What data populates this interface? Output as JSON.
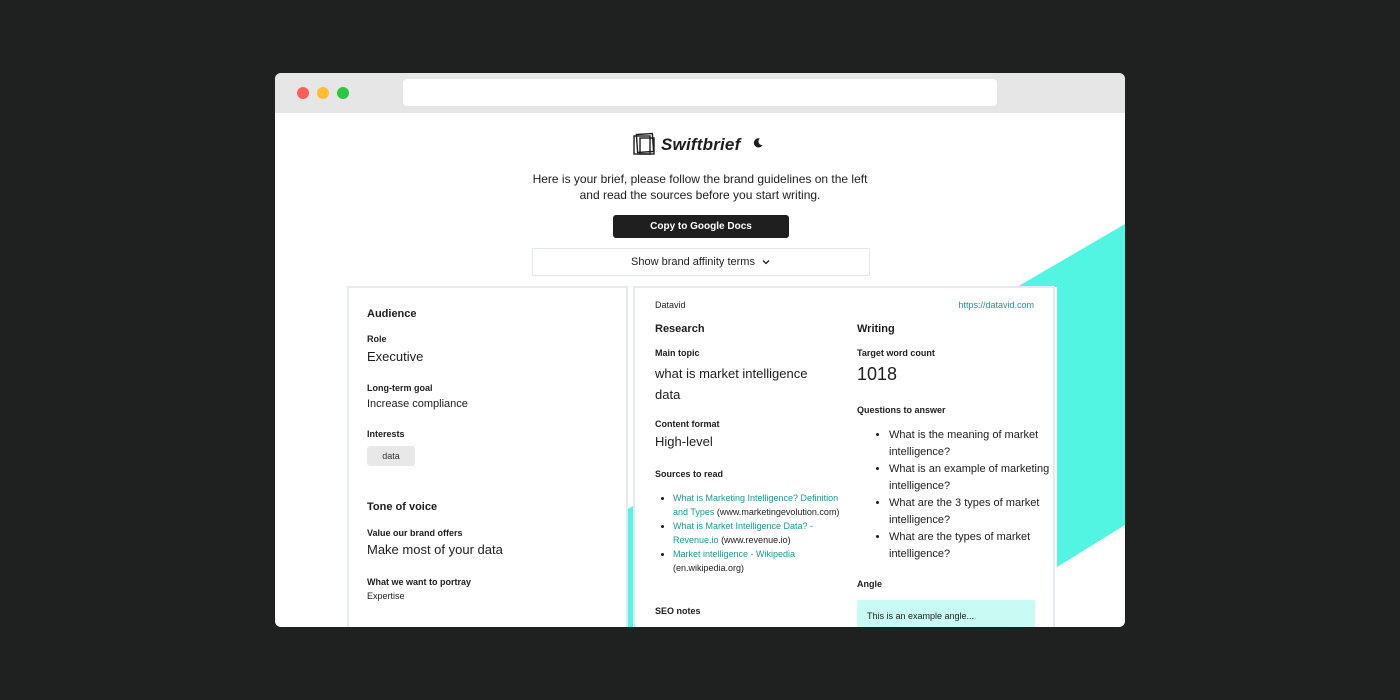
{
  "app": {
    "brand_name": "Swiftbrief",
    "intro_text": "Here is your brief, please follow the brand guidelines on the left and read the sources before you start writing.",
    "copy_button_label": "Copy to Google Docs",
    "affinity_toggle_label": "Show brand affinity terms",
    "accent_color": "#52f5e2"
  },
  "audience": {
    "heading": "Audience",
    "role_label": "Role",
    "role_value": "Executive",
    "goal_label": "Long-term goal",
    "goal_value": "Increase compliance",
    "interests_label": "Interests",
    "interests": [
      "data"
    ]
  },
  "tone": {
    "heading": "Tone of voice",
    "value_label": "Value our brand offers",
    "value_value": "Make most of your data",
    "portray_label": "What we want to portray",
    "portray_value": "Expertise"
  },
  "brief": {
    "company": "Datavid",
    "company_url": "https://datavid.com",
    "research": {
      "heading": "Research",
      "topic_label": "Main topic",
      "topic_value": "what is market intelligence data",
      "format_label": "Content format",
      "format_value": "High-level",
      "sources_label": "Sources to read",
      "sources": [
        {
          "title": "What is Marketing Intelligence? Definition and Types",
          "domain": "(www.marketingevolution.com)"
        },
        {
          "title": "What is Market Intelligence Data? - Revenue.io",
          "domain": "(www.revenue.io)"
        },
        {
          "title": "Market intelligence - Wikipedia",
          "domain": "(en.wikipedia.org)"
        }
      ],
      "seo_label": "SEO notes"
    },
    "writing": {
      "heading": "Writing",
      "word_count_label": "Target word count",
      "word_count_value": "1018",
      "questions_label": "Questions to answer",
      "questions": [
        "What is the meaning of market intelligence?",
        "What is an example of marketing intelligence?",
        "What are the 3 types of market intelligence?",
        "What are the types of market intelligence?"
      ],
      "angle_label": "Angle",
      "angle_placeholder": "This is an example angle..."
    }
  }
}
